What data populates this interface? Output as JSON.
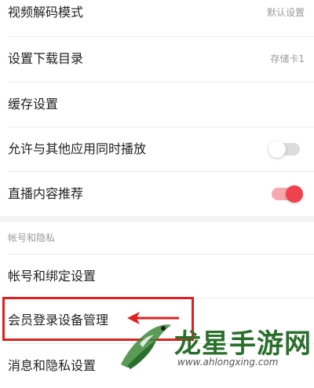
{
  "settings": {
    "video_decode": {
      "label": "视频解码模式",
      "value": "默认设置"
    },
    "download_dir": {
      "label": "设置下载目录",
      "value": "存储卡1"
    },
    "cache": {
      "label": "缓存设置"
    },
    "background_play": {
      "label": "允许与其他应用同时播放",
      "toggle": "off"
    },
    "live_recommend": {
      "label": "直播内容推荐",
      "toggle": "on"
    }
  },
  "account_section": {
    "header": "帐号和隐私",
    "account_binding": {
      "label": "帐号和绑定设置"
    },
    "device_management": {
      "label": "会员登录设备管理"
    },
    "message_privacy": {
      "label": "消息和隐私设置"
    }
  },
  "watermark": {
    "title": "龙星手游网",
    "url": "www.ahlongxing.com"
  },
  "colors": {
    "toggle_on": "#f0414e",
    "highlight": "#e02020",
    "watermark_green": "#2a6f2b"
  }
}
